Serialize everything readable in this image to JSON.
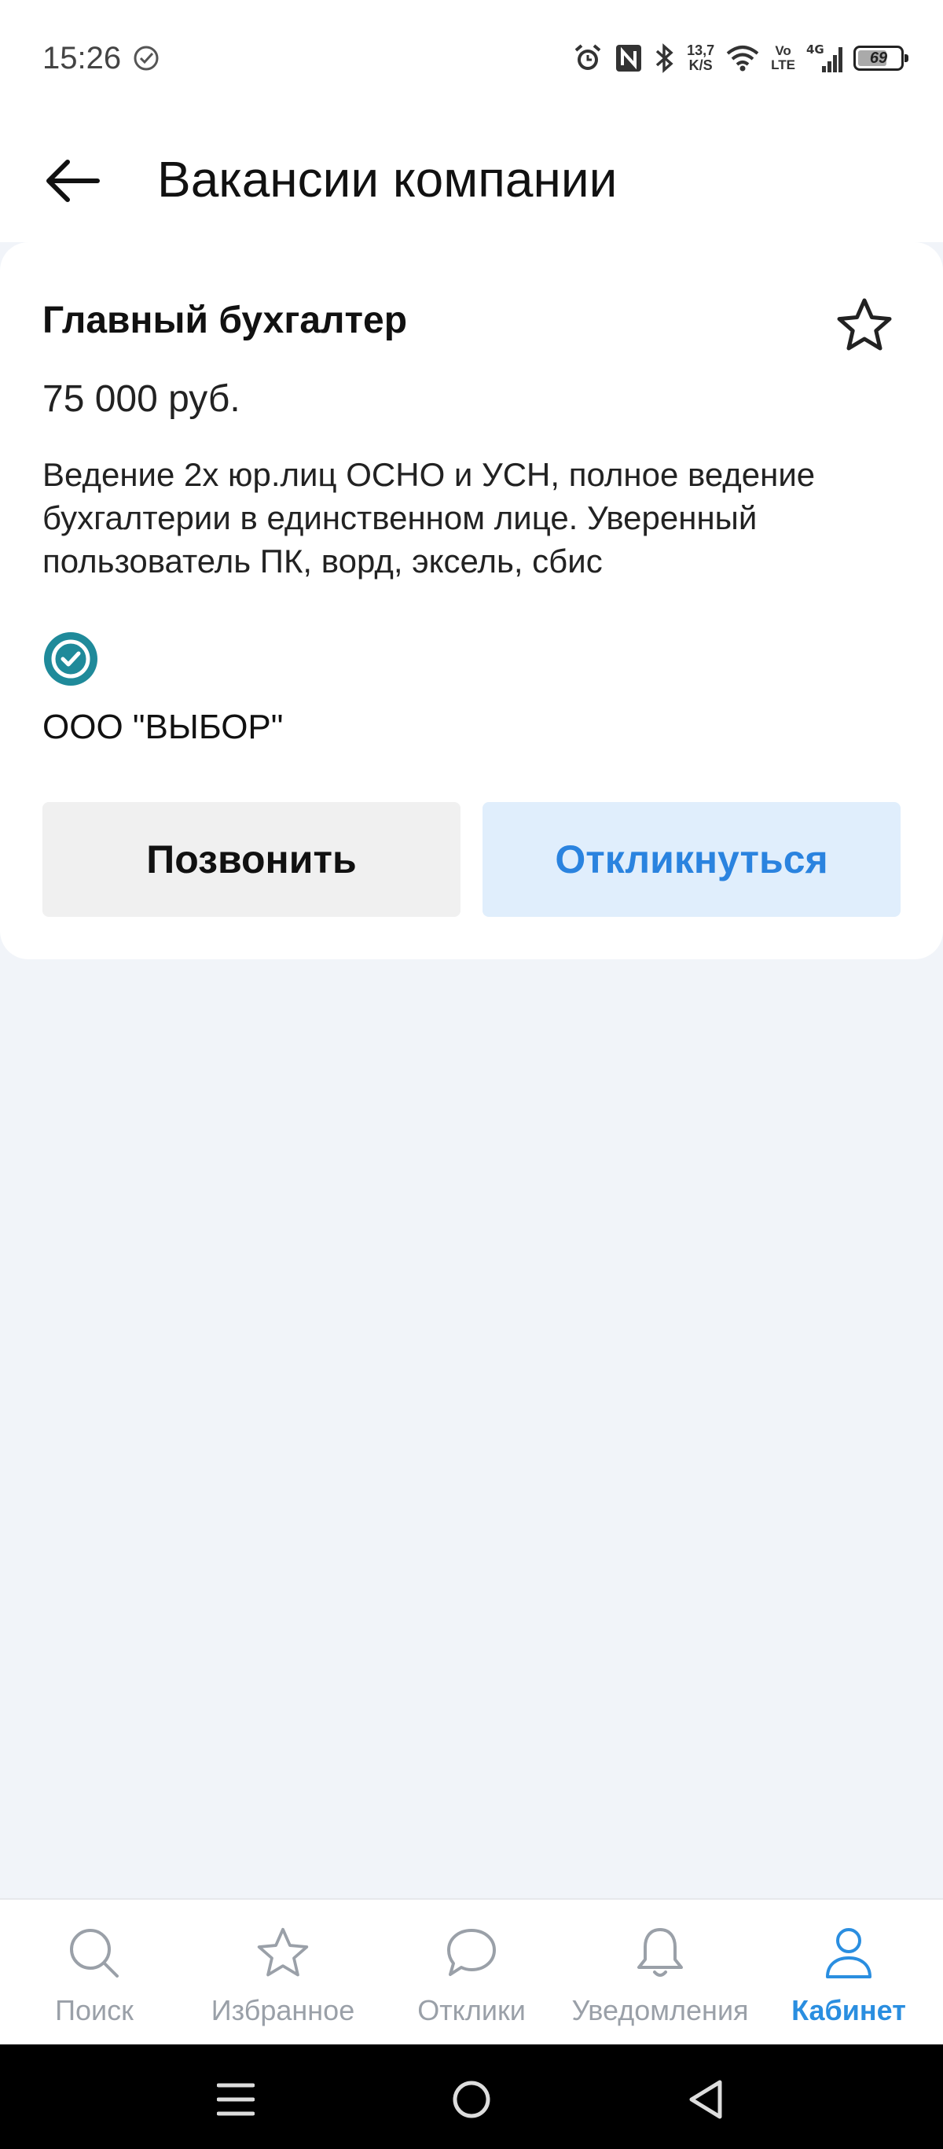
{
  "status_bar": {
    "time": "15:26",
    "speed_top": "13,7",
    "speed_bottom": "K/S",
    "volte_top": "Vo",
    "volte_bottom": "LTE",
    "network": "4G",
    "battery": "69",
    "battery_level": 0.69
  },
  "header": {
    "title": "Вакансии компании"
  },
  "vacancy": {
    "title": "Главный бухгалтер",
    "salary": "75 000 руб.",
    "description": "Ведение 2х юр.лиц ОСНО и УСН, полное ведение бухгалтерии в единственном лице. Уверенный пользователь ПК, ворд, эксель, сбис",
    "company": "ООО \"ВЫБОР\"",
    "call_label": "Позвонить",
    "apply_label": "Откликнуться"
  },
  "bottom_nav": {
    "items": [
      {
        "label": "Поиск",
        "icon": "search-icon"
      },
      {
        "label": "Избранное",
        "icon": "star-icon"
      },
      {
        "label": "Отклики",
        "icon": "chat-bubble-icon"
      },
      {
        "label": "Уведомления",
        "icon": "bell-icon"
      },
      {
        "label": "Кабинет",
        "icon": "user-icon",
        "active": true
      }
    ]
  },
  "colors": {
    "accent": "#2a8ee0",
    "apply_bg": "#e0eefc",
    "badge": "#1f8a9a",
    "page_bg": "#f1f4f9"
  }
}
